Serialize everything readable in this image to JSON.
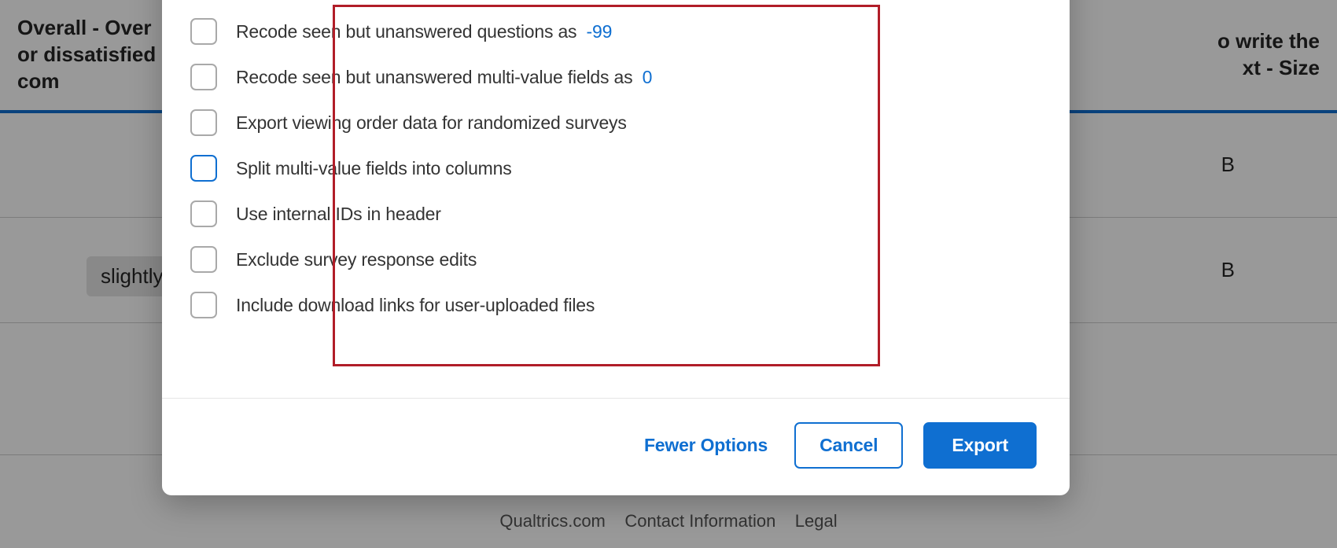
{
  "colors": {
    "accent": "#0f6fd1",
    "highlight_border": "#B11D28"
  },
  "background": {
    "left_header_fragment": "Overall - Over\nor dissatisfied\ncom",
    "right_header_fragment": "o write the\nxt - Size",
    "row1_right": "B",
    "row2_left": "slightly",
    "row2_right": " B",
    "footer_links_fragment": "Qualtrics.com    Contact Information    Legal"
  },
  "modal": {
    "options": [
      {
        "key": "recode_unanswered",
        "label_prefix": "Recode seen but unanswered questions as",
        "value": "-99",
        "checked": false,
        "active": false
      },
      {
        "key": "recode_multivalue",
        "label_prefix": "Recode seen but unanswered multi-value fields as",
        "value": "0",
        "checked": false,
        "active": false
      },
      {
        "key": "export_viewing_order",
        "label": "Export viewing order data for randomized surveys",
        "checked": false,
        "active": false
      },
      {
        "key": "split_multivalue",
        "label": "Split multi-value fields into columns",
        "checked": false,
        "active": true
      },
      {
        "key": "internal_ids",
        "label": "Use internal IDs in header",
        "checked": false,
        "active": false
      },
      {
        "key": "exclude_edits",
        "label": "Exclude survey response edits",
        "checked": false,
        "active": false
      },
      {
        "key": "include_download_links",
        "label": "Include download links for user-uploaded files",
        "checked": false,
        "active": false
      }
    ],
    "footer": {
      "fewer_options": "Fewer Options",
      "cancel": "Cancel",
      "export": "Export"
    }
  }
}
